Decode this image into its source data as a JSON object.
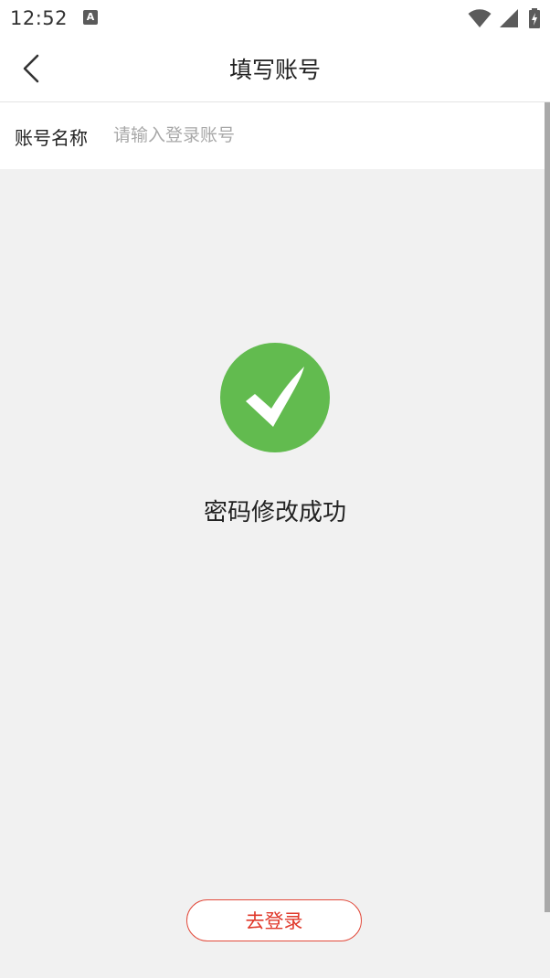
{
  "status_bar": {
    "time": "12:52",
    "notification_icon_letter": "A",
    "icons": [
      "wifi-icon",
      "signal-icon",
      "battery-charging-icon"
    ]
  },
  "header": {
    "title": "填写账号",
    "back_icon": "chevron-left-icon"
  },
  "form": {
    "account_label": "账号名称",
    "account_value": "",
    "account_placeholder": "请输入登录账号"
  },
  "result": {
    "icon": "check-circle-icon",
    "message": "密码修改成功"
  },
  "actions": {
    "login_label": "去登录"
  },
  "colors": {
    "success": "#62bb4f",
    "accent": "#e0392b",
    "background": "#f1f1f1"
  }
}
